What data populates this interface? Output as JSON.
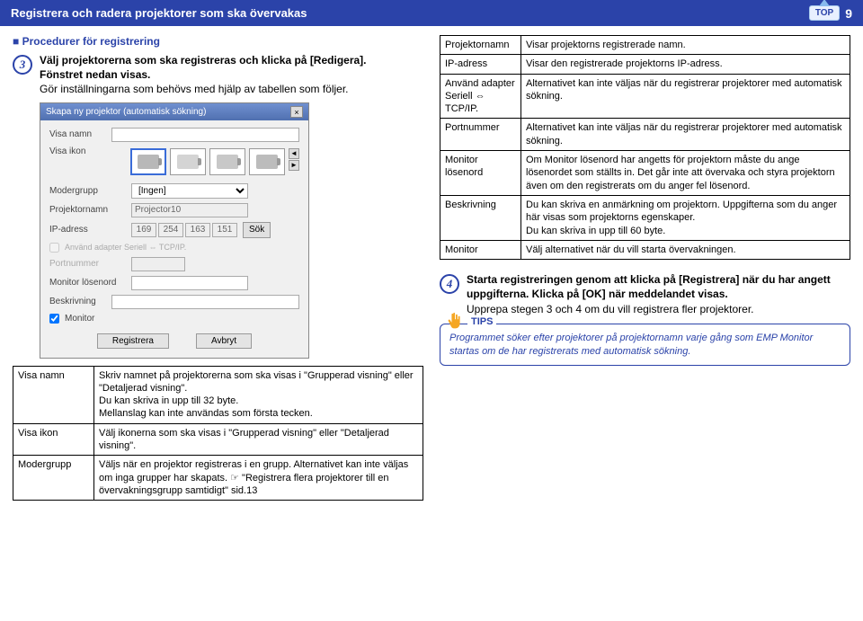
{
  "header": {
    "title": "Registrera och radera projektorer som ska övervakas",
    "top_label": "TOP",
    "page_number": "9"
  },
  "section_title": "Procedurer för registrering",
  "step3": {
    "num": "3",
    "line1a": "Välj projektorerna som ska registreras och klicka på ",
    "line1b": "[Redigera].",
    "line2": "Fönstret nedan visas.",
    "line3": "Gör inställningarna som behövs med hjälp av tabellen som följer."
  },
  "dialog": {
    "title": "Skapa ny projektor (automatisk sökning)",
    "labels": {
      "visa_namn": "Visa namn",
      "visa_ikon": "Visa ikon",
      "modergrupp": "Modergrupp",
      "projektornamn": "Projektornamn",
      "ip": "IP-adress",
      "adapter": "Använd adapter Seriell ⇔ TCP/IP.",
      "portnummer": "Portnummer",
      "monitor_pw": "Monitor lösenord",
      "beskrivning": "Beskrivning",
      "monitor": "Monitor"
    },
    "values": {
      "modergrupp_opt": "[Ingen]",
      "projektornamn": "Projector10",
      "ip": [
        "169",
        "254",
        "163",
        "151"
      ],
      "sok": "Sök"
    },
    "buttons": {
      "register": "Registrera",
      "cancel": "Avbryt"
    }
  },
  "left_table": [
    {
      "k": "Visa namn",
      "v": "Skriv namnet på projektorerna som ska visas i \"Grupperad visning\" eller \"Detaljerad visning\".\nDu kan skriva in upp till 32 byte.\nMellanslag kan inte användas som första tecken."
    },
    {
      "k": "Visa ikon",
      "v": "Välj ikonerna som ska visas i \"Grupperad visning\" eller \"Detaljerad visning\"."
    },
    {
      "k": "Modergrupp",
      "v": "Väljs när en projektor registreras i en grupp. Alternativet kan inte väljas om inga grupper har skapats. ☞ \"Registrera flera projektorer till en övervakningsgrupp samtidigt\" sid.13"
    }
  ],
  "right_table": [
    {
      "k": "Projektornamn",
      "v": "Visar projektorns registrerade namn."
    },
    {
      "k": "IP-adress",
      "v": "Visar den registrerade projektorns IP-adress."
    },
    {
      "k": "Använd adapter Seriell ⇔ TCP/IP.",
      "v": "Alternativet kan inte väljas när du registrerar projektorer med automatisk sökning."
    },
    {
      "k": "Portnummer",
      "v": "Alternativet kan inte väljas när du registrerar projektorer med automatisk sökning."
    },
    {
      "k": "Monitor lösenord",
      "v": "Om Monitor lösenord har angetts för projektorn måste du ange lösenordet som ställts in. Det går inte att övervaka och styra projektorn även om den registrerats om du anger fel lösenord."
    },
    {
      "k": "Beskrivning",
      "v": "Du kan skriva en anmärkning om projektorn. Uppgifterna som du anger här visas som projektorns egenskaper.\nDu kan skriva in upp till 60 byte."
    },
    {
      "k": "Monitor",
      "v": "Välj alternativet när du vill starta övervakningen."
    }
  ],
  "step4": {
    "num": "4",
    "bold": "Starta registreringen genom att klicka på [Registrera] när du har angett uppgifterna. Klicka på [OK] när meddelandet visas.",
    "plain": "Upprepa stegen 3 och 4 om du vill registrera fler projektorer."
  },
  "tips": {
    "label": "TIPS",
    "text": "Programmet söker efter projektorer på projektornamn varje gång som EMP Monitor startas om de har registrerats med automatisk sökning."
  }
}
